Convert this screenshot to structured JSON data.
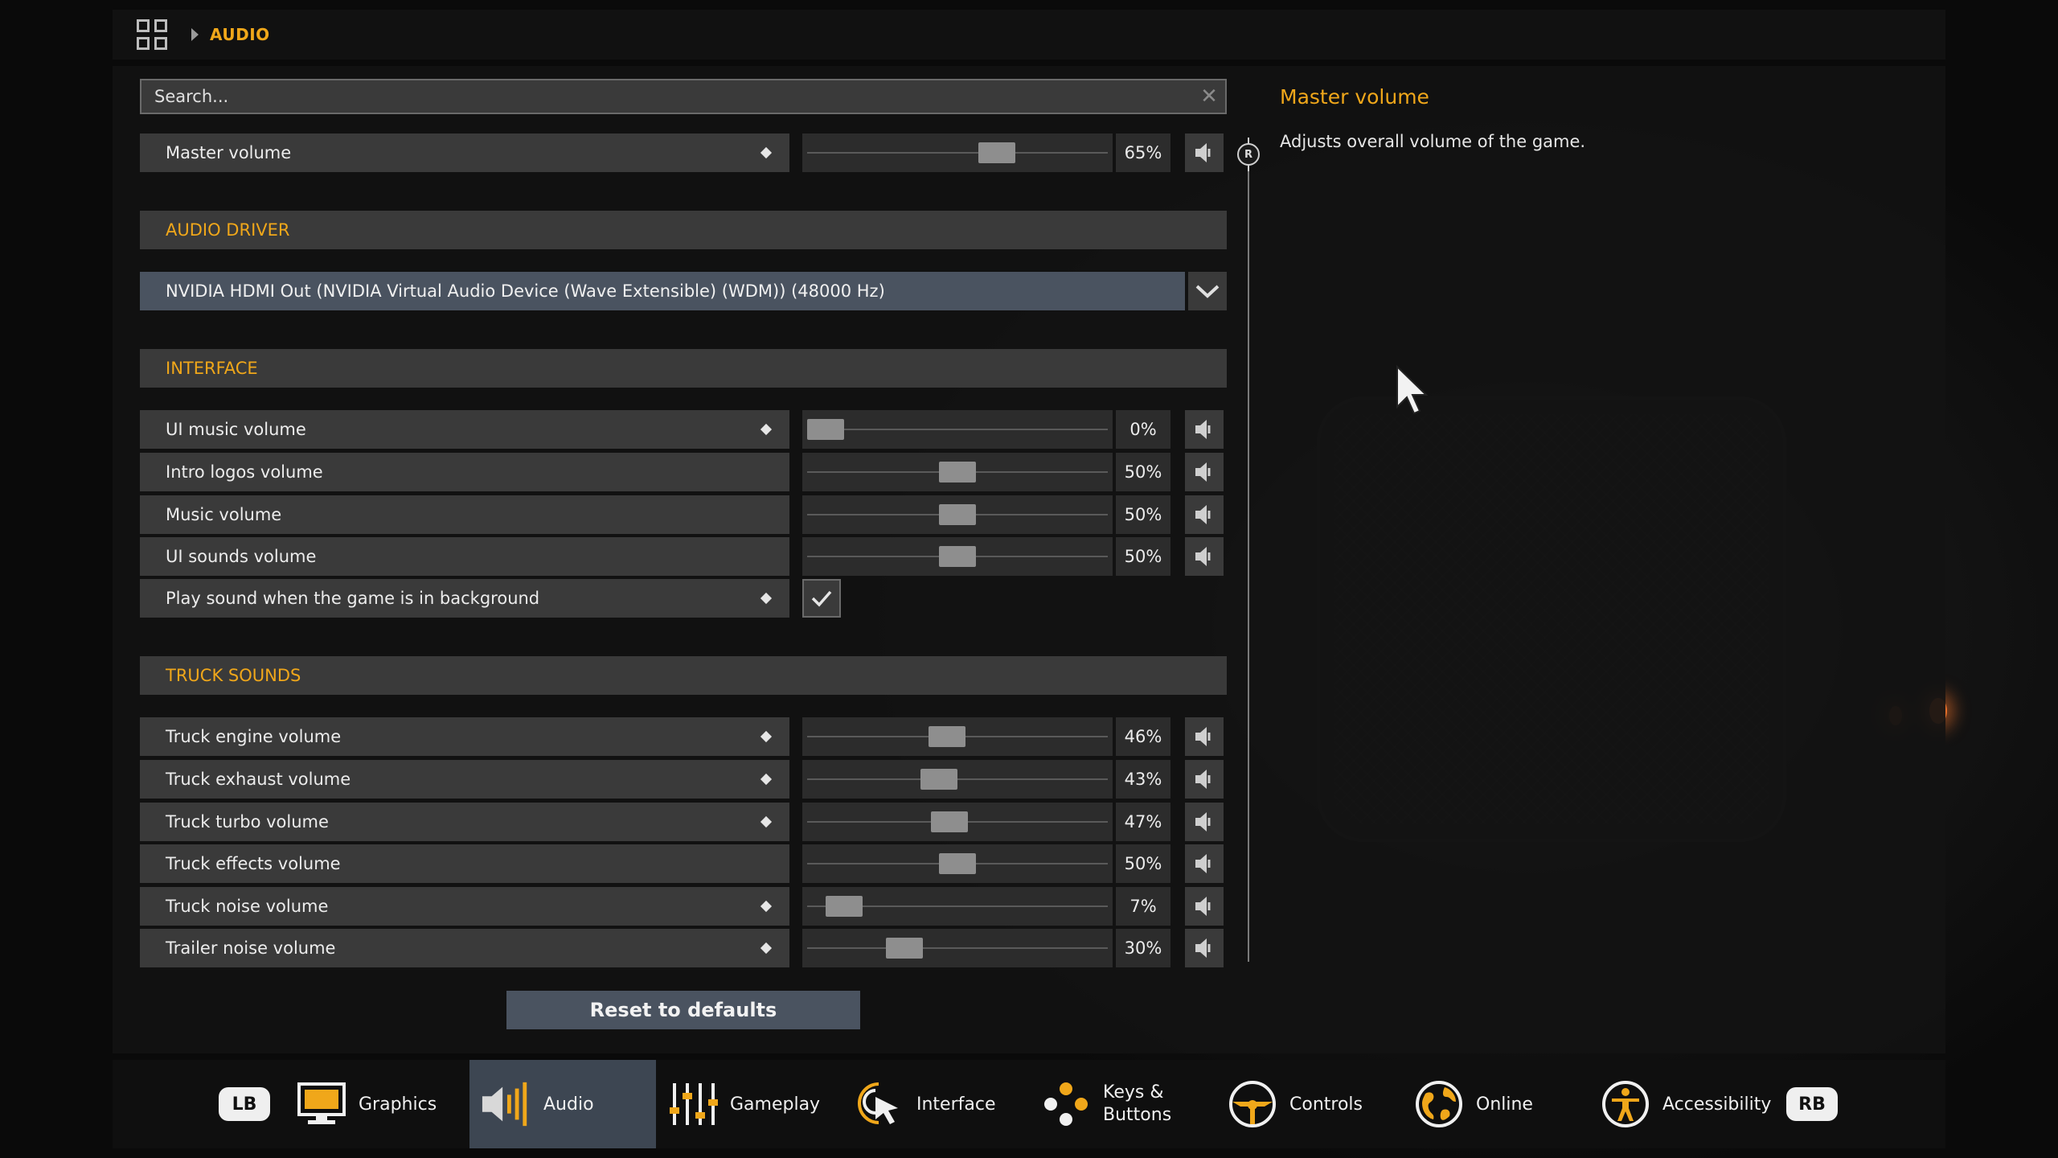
{
  "breadcrumb": {
    "current": "AUDIO"
  },
  "search": {
    "placeholder": "Search..."
  },
  "master": {
    "label": "Master volume",
    "value_text": "65%",
    "value": 0.65
  },
  "audio_driver": {
    "heading": "AUDIO DRIVER",
    "selected": "NVIDIA HDMI Out (NVIDIA Virtual Audio Device (Wave Extensible) (WDM)) (48000 Hz)"
  },
  "interface": {
    "heading": "INTERFACE",
    "rows": [
      {
        "label": "UI music volume",
        "value_text": "0%",
        "value": 0.0
      },
      {
        "label": "Intro logos volume",
        "value_text": "50%",
        "value": 0.5
      },
      {
        "label": "Music volume",
        "value_text": "50%",
        "value": 0.5
      },
      {
        "label": "UI sounds volume",
        "value_text": "50%",
        "value": 0.5
      }
    ],
    "background_sound": {
      "label": "Play sound when the game is in background",
      "checked": true
    }
  },
  "truck_sounds": {
    "heading": "TRUCK SOUNDS",
    "rows": [
      {
        "label": "Truck engine volume",
        "value_text": "46%",
        "value": 0.46
      },
      {
        "label": "Truck exhaust volume",
        "value_text": "43%",
        "value": 0.43
      },
      {
        "label": "Truck turbo volume",
        "value_text": "47%",
        "value": 0.47
      },
      {
        "label": "Truck effects volume",
        "value_text": "50%",
        "value": 0.5
      },
      {
        "label": "Truck noise volume",
        "value_text": "7%",
        "value": 0.07
      },
      {
        "label": "Trailer noise volume",
        "value_text": "30%",
        "value": 0.3
      }
    ]
  },
  "help": {
    "title": "Master volume",
    "text": "Adjusts overall volume of the game."
  },
  "reset": {
    "label": "Reset to defaults"
  },
  "tabs": {
    "lb": "LB",
    "rb": "RB",
    "graphics": "Graphics",
    "audio": "Audio",
    "gameplay": "Gameplay",
    "interface": "Interface",
    "keys_line1": "Keys &",
    "keys_line2": "Buttons",
    "controls": "Controls",
    "online": "Online",
    "accessibility": "Accessibility"
  },
  "colors": {
    "accent": "#f0a71a",
    "active_tab": "#3d4652",
    "row_bg": "#3a3a3a"
  }
}
